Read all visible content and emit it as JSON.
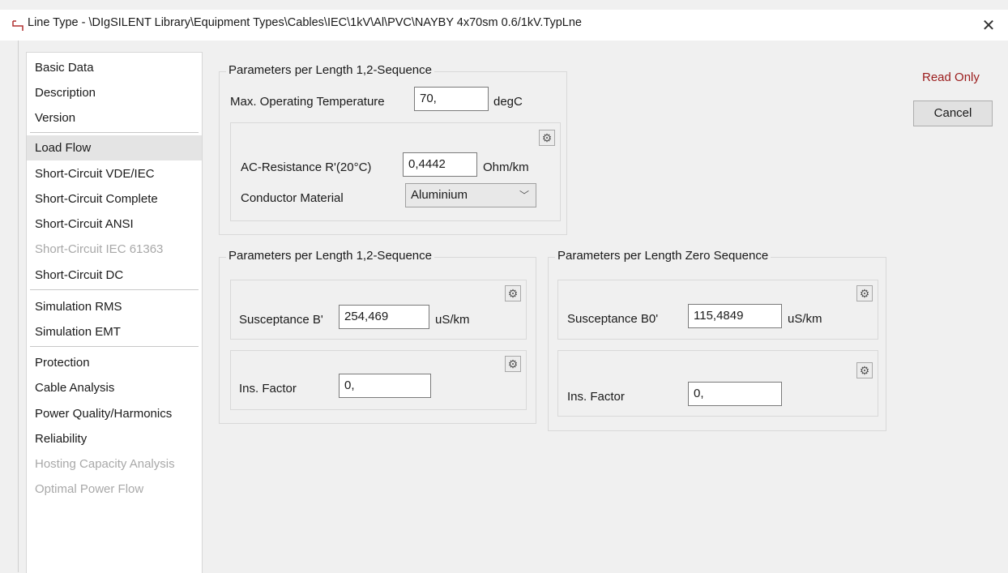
{
  "window": {
    "title": "Line Type - \\DIgSILENT Library\\Equipment Types\\Cables\\IEC\\1kV\\Al\\PVC\\NAYBY 4x70sm 0.6/1kV.TypLne",
    "close_icon": "close-icon"
  },
  "nav": {
    "items": [
      {
        "label": "Basic Data",
        "state": "normal"
      },
      {
        "label": "Description",
        "state": "normal"
      },
      {
        "label": "Version",
        "state": "normal"
      },
      {
        "label": "Load Flow",
        "state": "selected"
      },
      {
        "label": "Short-Circuit VDE/IEC",
        "state": "normal"
      },
      {
        "label": "Short-Circuit Complete",
        "state": "normal"
      },
      {
        "label": "Short-Circuit ANSI",
        "state": "normal"
      },
      {
        "label": "Short-Circuit IEC 61363",
        "state": "disabled"
      },
      {
        "label": "Short-Circuit DC",
        "state": "normal"
      },
      {
        "label": "Simulation RMS",
        "state": "normal"
      },
      {
        "label": "Simulation EMT",
        "state": "normal"
      },
      {
        "label": "Protection",
        "state": "normal"
      },
      {
        "label": "Cable Analysis",
        "state": "normal"
      },
      {
        "label": "Power Quality/Harmonics",
        "state": "normal"
      },
      {
        "label": "Reliability",
        "state": "normal"
      },
      {
        "label": "Hosting Capacity Analysis",
        "state": "disabled"
      },
      {
        "label": "Optimal Power Flow",
        "state": "disabled"
      }
    ]
  },
  "group1": {
    "title": "Parameters per Length 1,2-Sequence",
    "max_temp_label": "Max. Operating Temperature",
    "max_temp_value": "70,",
    "max_temp_unit": "degC",
    "ac_res_label": "AC-Resistance R'(20°C)",
    "ac_res_value": "0,4442",
    "ac_res_unit": "Ohm/km",
    "conductor_label": "Conductor Material",
    "conductor_value": "Aluminium"
  },
  "group2": {
    "title": "Parameters per Length 1,2-Sequence",
    "susceptance_label": "Susceptance B'",
    "susceptance_value": "254,469",
    "susceptance_unit": "uS/km",
    "ins_label": "Ins. Factor",
    "ins_value": "0,"
  },
  "group3": {
    "title": "Parameters per Length Zero Sequence",
    "susceptance_label": "Susceptance B0'",
    "susceptance_value": "115,4849",
    "susceptance_unit": "uS/km",
    "ins_label": "Ins. Factor",
    "ins_value": "0,"
  },
  "actions": {
    "read_only": "Read Only",
    "cancel": "Cancel"
  },
  "colors": {
    "read_only": "#9b1c1c",
    "selected_nav": "#e4e4e4",
    "disabled_text": "#a8a8a8"
  }
}
